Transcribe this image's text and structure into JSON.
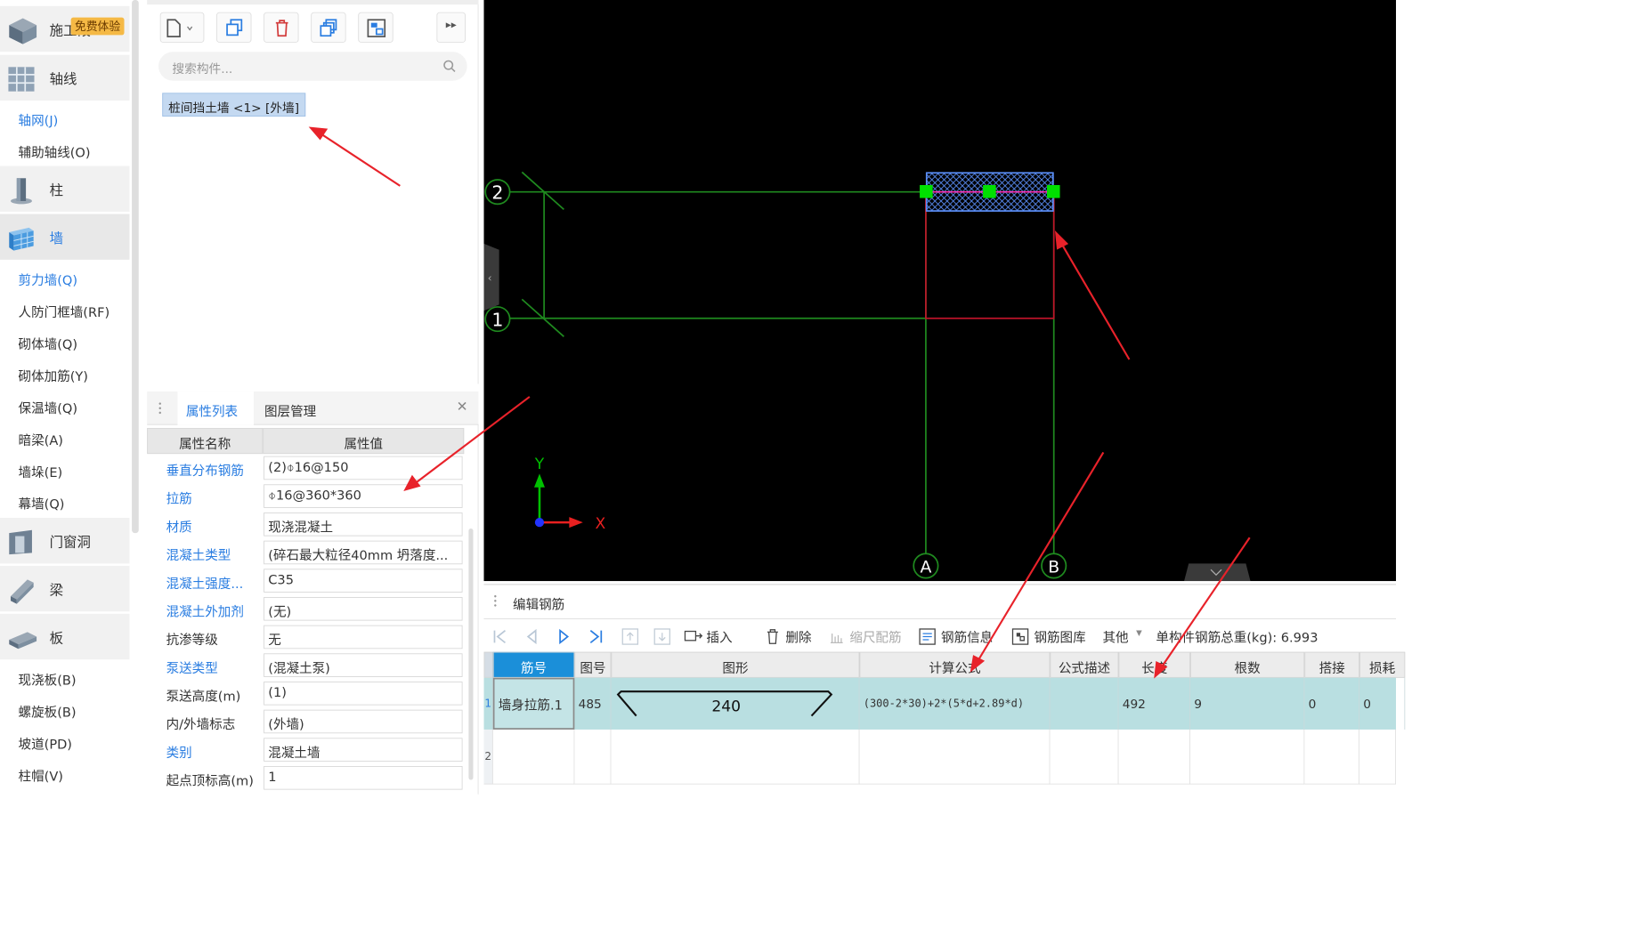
{
  "sidebar": {
    "badge": "免费体验",
    "categories": [
      {
        "label": "施工段",
        "icon": "cube-icon"
      },
      {
        "label": "轴线",
        "icon": "grid-icon"
      },
      {
        "label": "柱",
        "icon": "column-icon"
      },
      {
        "label": "墙",
        "icon": "wall-icon"
      },
      {
        "label": "门窗洞",
        "icon": "door-window-icon"
      },
      {
        "label": "梁",
        "icon": "beam-icon"
      },
      {
        "label": "板",
        "icon": "slab-icon"
      }
    ],
    "axis_items": [
      "轴网(J)",
      "辅助轴线(O)"
    ],
    "wall_items": [
      "剪力墙(Q)",
      "人防门框墙(RF)",
      "砌体墙(Q)",
      "砌体加筋(Y)",
      "保温墙(Q)",
      "暗梁(A)",
      "墙垛(E)",
      "幕墙(Q)"
    ],
    "slab_items": [
      "现浇板(B)",
      "螺旋板(B)",
      "坡道(PD)",
      "柱帽(V)"
    ]
  },
  "components": {
    "search_placeholder": "搜索构件...",
    "selected_item": "桩间挡土墙 <1> [外墙]"
  },
  "properties": {
    "tabs": [
      "属性列表",
      "图层管理"
    ],
    "col_name": "属性名称",
    "col_value": "属性值",
    "rows": [
      {
        "name": "垂直分布钢筋",
        "value": "(2)⌽16@150",
        "blue": true
      },
      {
        "name": "拉筋",
        "value": "⌽16@360*360",
        "blue": true
      },
      {
        "name": "材质",
        "value": "现浇混凝土",
        "blue": true
      },
      {
        "name": "混凝土类型",
        "value": "(碎石最大粒径40mm 坍落度...",
        "blue": true
      },
      {
        "name": "混凝土强度...",
        "value": "C35",
        "blue": true
      },
      {
        "name": "混凝土外加剂",
        "value": "(无)",
        "blue": true
      },
      {
        "name": "抗渗等级",
        "value": "无",
        "blue": false
      },
      {
        "name": "泵送类型",
        "value": "(混凝土泵)",
        "blue": true
      },
      {
        "name": "泵送高度(m)",
        "value": "(1)",
        "blue": false
      },
      {
        "name": "内/外墙标志",
        "value": "(外墙)",
        "blue": false
      },
      {
        "name": "类别",
        "value": "混凝土墙",
        "blue": true
      },
      {
        "name": "起点顶标高(m)",
        "value": "1",
        "blue": false
      }
    ]
  },
  "canvas": {
    "axis_labels": [
      "2",
      "1",
      "A",
      "B"
    ],
    "y_label": "Y",
    "x_label": "X"
  },
  "rebar": {
    "title": "编辑钢筋",
    "toolbar": {
      "insert": "插入",
      "delete": "删除",
      "scale": "缩尺配筋",
      "info": "钢筋信息",
      "library": "钢筋图库",
      "other": "其他",
      "total": "单构件钢筋总重(kg): 6.993"
    },
    "columns": [
      "筋号",
      "图号",
      "图形",
      "计算公式",
      "公式描述",
      "长度",
      "根数",
      "搭接",
      "损耗"
    ],
    "row": {
      "index": "1",
      "name": "墙身拉筋.1",
      "fig_no": "485",
      "shape_value": "240",
      "formula": "(300-2*30)+2*(5*d+2.89*d)",
      "description": "",
      "length": "492",
      "count": "9",
      "lap": "0",
      "loss": "0"
    },
    "row2_index": "2"
  },
  "colors": {
    "accent": "#2a7de1",
    "grid_green": "#1f8a1f",
    "wall_red": "#c0142a",
    "selection_blue": "#5b8ff9",
    "grip_green": "#00e000",
    "arrow_red": "#e8222a"
  }
}
